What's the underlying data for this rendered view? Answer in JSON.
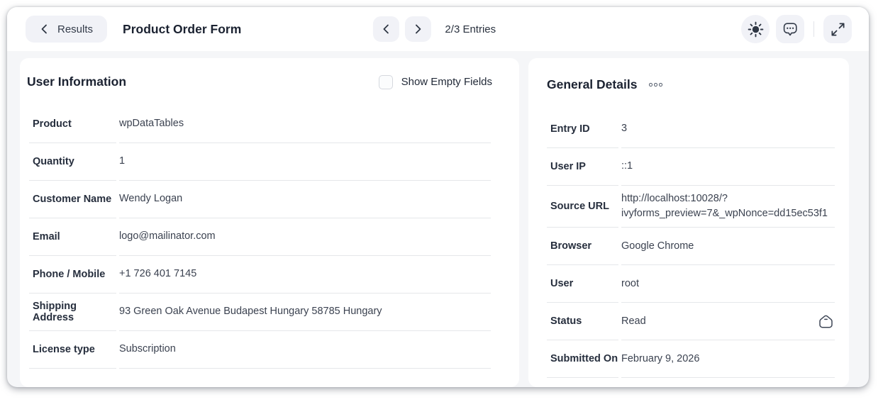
{
  "header": {
    "back_label": "Results",
    "title": "Product Order Form",
    "entries_counter": "2/3 Entries"
  },
  "left_panel": {
    "title": "User Information",
    "show_empty_label": "Show Empty Fields",
    "show_empty_checked": false,
    "rows": [
      {
        "label": "Product",
        "value": "wpDataTables"
      },
      {
        "label": "Quantity",
        "value": "1"
      },
      {
        "label": "Customer Name",
        "value": "Wendy Logan"
      },
      {
        "label": "Email",
        "value": "logo@mailinator.com"
      },
      {
        "label": "Phone / Mobile",
        "value": "+1 726 401 7145"
      },
      {
        "label": "Shipping Address",
        "value": "93 Green Oak Avenue Budapest Hungary 58785 Hungary"
      },
      {
        "label": "License type",
        "value": "Subscription"
      }
    ]
  },
  "right_panel": {
    "title": "General Details",
    "rows": [
      {
        "label": "Entry ID",
        "value": "3"
      },
      {
        "label": "User IP",
        "value": "::1"
      },
      {
        "label": "Source URL",
        "value": "http://localhost:10028/?ivyforms_preview=7&_wpNonce=dd15ec53f1"
      },
      {
        "label": "Browser",
        "value": "Google Chrome"
      },
      {
        "label": "User",
        "value": "root"
      },
      {
        "label": "Status",
        "value": "Read",
        "icon": "mail-open-icon"
      },
      {
        "label": "Submitted On",
        "value": "February 9, 2026"
      }
    ]
  },
  "icons": {
    "back": "chevron-left-icon",
    "prev": "chevron-left-icon",
    "next": "chevron-right-icon",
    "brightness": "sun-icon",
    "notes": "comment-dots-icon",
    "fullscreen": "expand-arrows-icon",
    "more": "dots-menu-icon",
    "status_read": "mail-open-icon"
  },
  "colors": {
    "card_bg": "#f5f6f8",
    "panel_bg": "#ffffff",
    "pill_bg": "#f1f2f7",
    "divider": "#e5e7ea",
    "heading_text": "#1b2231",
    "label_text": "#262e3d",
    "value_text": "#3b4250",
    "icon_stroke": "#2f3744"
  }
}
